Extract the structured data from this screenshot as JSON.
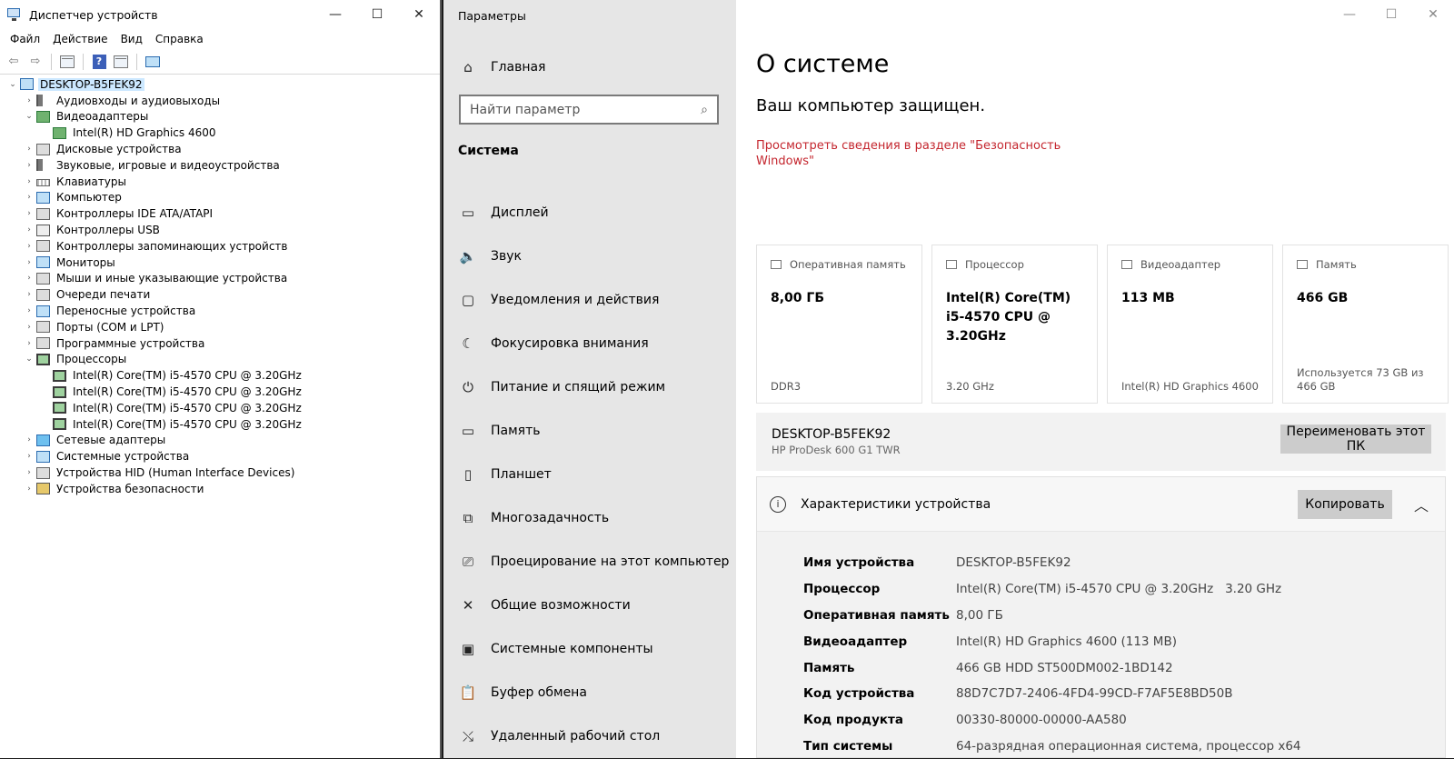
{
  "device_manager": {
    "title": "Диспетчер устройств",
    "window_controls": {
      "minimize": "—",
      "maximize": "☐",
      "close": "✕"
    },
    "menu": [
      "Файл",
      "Действие",
      "Вид",
      "Справка"
    ],
    "tree": {
      "root": "DESKTOP-B5FEK92",
      "items": [
        {
          "label": "Аудиовходы и аудиовыходы",
          "expanded": false,
          "icon": "audio-icon"
        },
        {
          "label": "Видеоадаптеры",
          "expanded": true,
          "icon": "display-adapter-icon"
        },
        {
          "label": "Intel(R) HD Graphics 4600",
          "child": true,
          "icon": "display-adapter-icon"
        },
        {
          "label": "Дисковые устройства",
          "expanded": false,
          "icon": "disk-icon"
        },
        {
          "label": "Звуковые, игровые и видеоустройства",
          "expanded": false,
          "icon": "speaker-icon"
        },
        {
          "label": "Клавиатуры",
          "expanded": false,
          "icon": "keyboard-icon"
        },
        {
          "label": "Компьютер",
          "expanded": false,
          "icon": "computer-icon"
        },
        {
          "label": "Контроллеры IDE ATA/ATAPI",
          "expanded": false,
          "icon": "ide-controller-icon"
        },
        {
          "label": "Контроллеры USB",
          "expanded": false,
          "icon": "usb-icon"
        },
        {
          "label": "Контроллеры запоминающих устройств",
          "expanded": false,
          "icon": "storage-controller-icon"
        },
        {
          "label": "Мониторы",
          "expanded": false,
          "icon": "monitor-icon"
        },
        {
          "label": "Мыши и иные указывающие устройства",
          "expanded": false,
          "icon": "mouse-icon"
        },
        {
          "label": "Очереди печати",
          "expanded": false,
          "icon": "printer-icon"
        },
        {
          "label": "Переносные устройства",
          "expanded": false,
          "icon": "portable-device-icon"
        },
        {
          "label": "Порты (COM и LPT)",
          "expanded": false,
          "icon": "port-icon"
        },
        {
          "label": "Программные устройства",
          "expanded": false,
          "icon": "software-device-icon"
        },
        {
          "label": "Процессоры",
          "expanded": true,
          "icon": "processor-icon"
        },
        {
          "label": "Intel(R) Core(TM) i5-4570 CPU @ 3.20GHz",
          "child": true,
          "icon": "processor-icon"
        },
        {
          "label": "Intel(R) Core(TM) i5-4570 CPU @ 3.20GHz",
          "child": true,
          "icon": "processor-icon"
        },
        {
          "label": "Intel(R) Core(TM) i5-4570 CPU @ 3.20GHz",
          "child": true,
          "icon": "processor-icon"
        },
        {
          "label": "Intel(R) Core(TM) i5-4570 CPU @ 3.20GHz",
          "child": true,
          "icon": "processor-icon"
        },
        {
          "label": "Сетевые адаптеры",
          "expanded": false,
          "icon": "network-adapter-icon"
        },
        {
          "label": "Системные устройства",
          "expanded": false,
          "icon": "system-device-icon"
        },
        {
          "label": "Устройства HID (Human Interface Devices)",
          "expanded": false,
          "icon": "hid-icon"
        },
        {
          "label": "Устройства безопасности",
          "expanded": false,
          "icon": "security-device-icon"
        }
      ]
    }
  },
  "settings": {
    "title": "Параметры",
    "window_controls": {
      "minimize": "—",
      "maximize": "☐",
      "close": "✕"
    },
    "nav": {
      "home": "Главная",
      "search_placeholder": "Найти параметр",
      "section": "Система",
      "items": [
        {
          "label": "Дисплей",
          "icon": "display-icon",
          "glyph": "▭"
        },
        {
          "label": "Звук",
          "icon": "sound-icon",
          "glyph": "🔈"
        },
        {
          "label": "Уведомления и действия",
          "icon": "notifications-icon",
          "glyph": "▢"
        },
        {
          "label": "Фокусировка внимания",
          "icon": "focus-assist-icon",
          "glyph": "☾"
        },
        {
          "label": "Питание и спящий режим",
          "icon": "power-icon",
          "glyph": "⏻"
        },
        {
          "label": "Память",
          "icon": "storage-icon",
          "glyph": "▭"
        },
        {
          "label": "Планшет",
          "icon": "tablet-icon",
          "glyph": "▯"
        },
        {
          "label": "Многозадачность",
          "icon": "multitasking-icon",
          "glyph": "⧉"
        },
        {
          "label": "Проецирование на этот компьютер",
          "icon": "projecting-icon",
          "glyph": "⎚"
        },
        {
          "label": "Общие возможности",
          "icon": "shared-experiences-icon",
          "glyph": "✕"
        },
        {
          "label": "Системные компоненты",
          "icon": "system-components-icon",
          "glyph": "▣"
        },
        {
          "label": "Буфер обмена",
          "icon": "clipboard-icon",
          "glyph": "📋"
        },
        {
          "label": "Удаленный рабочий стол",
          "icon": "remote-desktop-icon",
          "glyph": "⤯"
        }
      ]
    },
    "main": {
      "title": "О системе",
      "protection_title": "Ваш компьютер защищен.",
      "protection_link": "Просмотреть сведения в разделе \"Безопасность Windows\"",
      "cards": [
        {
          "label": "Оперативная память",
          "value": "8,00 ГБ",
          "foot": "DDR3",
          "icon": "ram-icon"
        },
        {
          "label": "Процессор",
          "value": "Intel(R) Core(TM) i5-4570 CPU @ 3.20GHz",
          "foot": "3.20 GHz",
          "icon": "cpu-icon"
        },
        {
          "label": "Видеоадаптер",
          "value": "113 MB",
          "foot": "Intel(R) HD Graphics 4600",
          "icon": "gpu-icon"
        },
        {
          "label": "Память",
          "value": "466 GB",
          "foot": "Используется 73 GB из 466 GB",
          "icon": "storage-icon"
        }
      ],
      "pc_name": "DESKTOP-B5FEK92",
      "pc_model": "HP ProDesk 600 G1 TWR",
      "rename_button": "Переименовать этот ПК",
      "specs_title": "Характеристики устройства",
      "copy_button": "Копировать",
      "specs": [
        {
          "key": "Имя устройства",
          "value": "DESKTOP-B5FEK92"
        },
        {
          "key": "Процессор",
          "value": "Intel(R) Core(TM) i5-4570 CPU @ 3.20GHz   3.20 GHz"
        },
        {
          "key": "Оперативная память",
          "value": "8,00 ГБ"
        },
        {
          "key": "Видеоадаптер",
          "value": "Intel(R) HD Graphics 4600 (113 MB)"
        },
        {
          "key": "Память",
          "value": "466 GB HDD ST500DM002-1BD142"
        },
        {
          "key": "Код устройства",
          "value": "88D7C7D7-2406-4FD4-99CD-F7AF5E8BD50B"
        },
        {
          "key": "Код продукта",
          "value": "00330-80000-00000-AA580"
        },
        {
          "key": "Тип системы",
          "value": "64-разрядная операционная система, процессор x64"
        }
      ]
    }
  }
}
